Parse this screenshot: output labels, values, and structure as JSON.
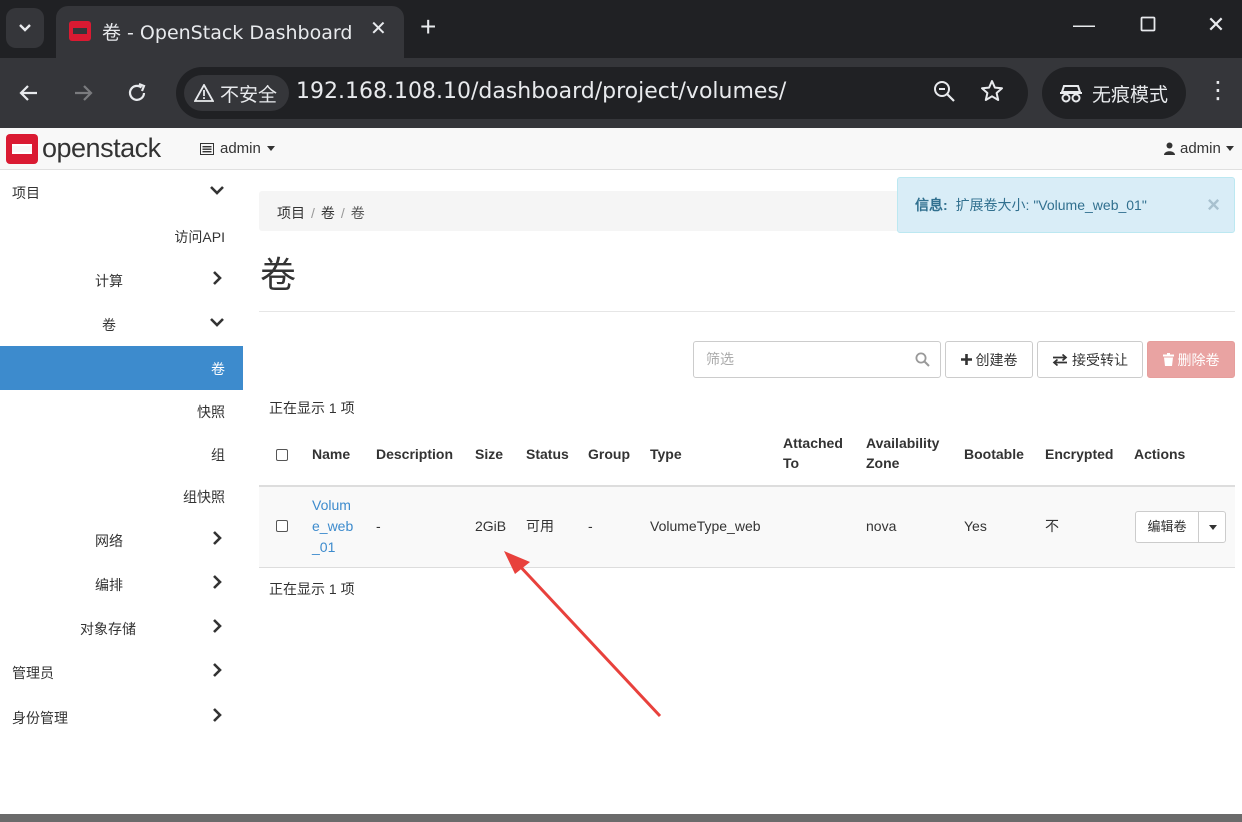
{
  "browser": {
    "tab_title": "卷 - OpenStack Dashboard",
    "security_label": "不安全",
    "url": "192.168.108.10/dashboard/project/volumes/",
    "incognito_label": "无痕模式"
  },
  "topnav": {
    "brand": "openstack",
    "project": "admin",
    "user": "admin"
  },
  "sidebar": {
    "items": [
      {
        "label": "项目"
      },
      {
        "label": "访问API"
      },
      {
        "label": "计算"
      },
      {
        "label": "卷"
      },
      {
        "label": "卷"
      },
      {
        "label": "快照"
      },
      {
        "label": "组"
      },
      {
        "label": "组快照"
      },
      {
        "label": "网络"
      },
      {
        "label": "编排"
      },
      {
        "label": "对象存储"
      },
      {
        "label": "管理员"
      },
      {
        "label": "身份管理"
      }
    ]
  },
  "breadcrumb": [
    "项目",
    "卷",
    "卷"
  ],
  "alert": {
    "label": "信息:",
    "message": "扩展卷大小: \"Volume_web_01\""
  },
  "page_title": "卷",
  "actions": {
    "filter_placeholder": "筛选",
    "create": "创建卷",
    "accept_transfer": "接受转让",
    "delete": "删除卷"
  },
  "count_text": "正在显示 1 项",
  "table": {
    "headers": {
      "name": "Name",
      "description": "Description",
      "size": "Size",
      "status": "Status",
      "group": "Group",
      "type": "Type",
      "attached_1": "Attached",
      "attached_2": "To",
      "zone_1": "Availability",
      "zone_2": "Zone",
      "bootable": "Bootable",
      "encrypted": "Encrypted",
      "actions": "Actions"
    },
    "rows": [
      {
        "name_1": "Volum",
        "name_2": "e_web",
        "name_3": "_01",
        "description": "-",
        "size": "2GiB",
        "status": "可用",
        "group": "-",
        "type": "VolumeType_web",
        "attached_to": "",
        "zone": "nova",
        "bootable": "Yes",
        "encrypted": "不",
        "action": "编辑卷"
      }
    ]
  },
  "colors": {
    "accent": "#3d8bcd",
    "brand_red": "#da1a32",
    "danger_button": "#e9a3a2",
    "annotation_arrow": "#e8413c"
  }
}
